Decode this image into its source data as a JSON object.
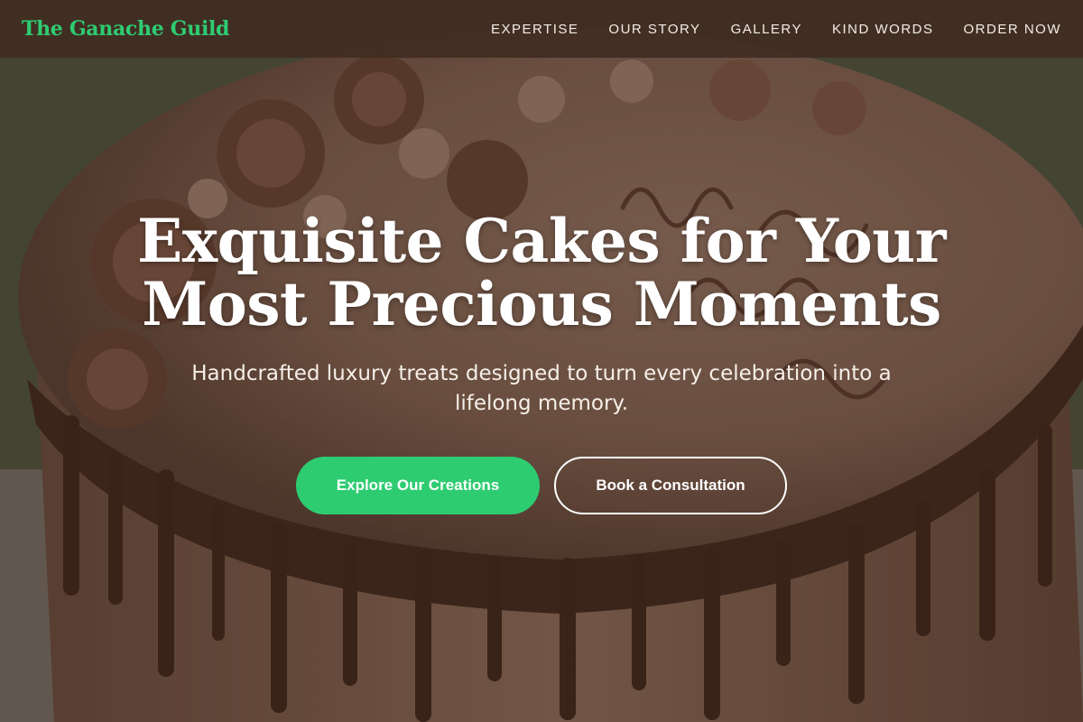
{
  "brand": {
    "name": "The Ganache Guild"
  },
  "nav": {
    "items": [
      {
        "label": "EXPERTISE"
      },
      {
        "label": "OUR STORY"
      },
      {
        "label": "GALLERY"
      },
      {
        "label": "KIND WORDS"
      },
      {
        "label": "ORDER NOW"
      }
    ]
  },
  "hero": {
    "headline_line1": "Exquisite Cakes for Your",
    "headline_line2": "Most Precious Moments",
    "subheadline": "Handcrafted luxury treats designed to turn every celebration into a lifelong memory.",
    "primary_button": "Explore Our Creations",
    "secondary_button": "Book a Consultation"
  },
  "colors": {
    "accent": "#2ecc71",
    "navbar_bg": "#402c22",
    "text_light": "#ffffff"
  }
}
